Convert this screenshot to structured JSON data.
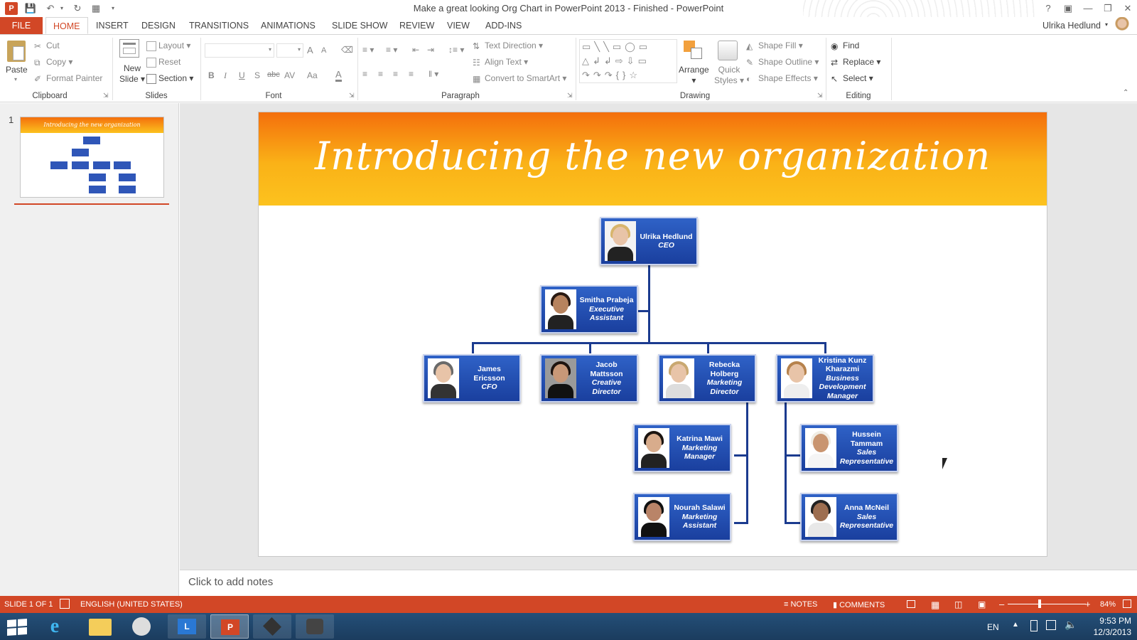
{
  "window": {
    "title": "Make a great looking Org Chart in PowerPoint 2013 - Finished - PowerPoint",
    "user": "Ulrika Hedlund",
    "help": "?"
  },
  "tabs": [
    "FILE",
    "HOME",
    "INSERT",
    "DESIGN",
    "TRANSITIONS",
    "ANIMATIONS",
    "SLIDE SHOW",
    "REVIEW",
    "VIEW",
    "ADD-INS"
  ],
  "ribbon": {
    "clipboard": {
      "paste": "Paste",
      "cut": "Cut",
      "copy": "Copy",
      "format_painter": "Format Painter",
      "label": "Clipboard"
    },
    "slides": {
      "new_slide_1": "New",
      "new_slide_2": "Slide",
      "layout": "Layout",
      "reset": "Reset",
      "section": "Section",
      "label": "Slides"
    },
    "font": {
      "label": "Font",
      "bold": "B",
      "italic": "I",
      "underline": "U",
      "shadow": "S",
      "strike": "abc",
      "spacing": "AV",
      "case": "Aa",
      "color": "A",
      "grow": "A",
      "shrink": "A"
    },
    "paragraph": {
      "label": "Paragraph",
      "text_direction": "Text Direction",
      "align_text": "Align Text",
      "convert": "Convert to SmartArt"
    },
    "drawing": {
      "label": "Drawing",
      "arrange": "Arrange",
      "quick_styles_1": "Quick",
      "quick_styles_2": "Styles",
      "shape_fill": "Shape Fill",
      "shape_outline": "Shape Outline",
      "shape_effects": "Shape Effects"
    },
    "editing": {
      "label": "Editing",
      "find": "Find",
      "replace": "Replace",
      "select": "Select"
    }
  },
  "slide_panel": {
    "number": "1"
  },
  "slide": {
    "title": "Introducing the new organization",
    "people": [
      {
        "name": "Ulrika Hedlund",
        "title": "CEO"
      },
      {
        "name": "Smitha Prabeja",
        "title": "Executive Assistant"
      },
      {
        "name": "James Ericsson",
        "title": "CFO"
      },
      {
        "name": "Jacob Mattsson",
        "title": "Creative Director"
      },
      {
        "name": "Rebecka Holberg",
        "title": "Marketing Director"
      },
      {
        "name": "Kristina Kunz Kharazmi",
        "title": "Business Development Manager"
      },
      {
        "name": "Katrina Mawi",
        "title": "Marketing Manager"
      },
      {
        "name": "Hussein Tammam",
        "title": "Sales Representative"
      },
      {
        "name": "Nourah Salawi",
        "title": "Marketing Assistant"
      },
      {
        "name": "Anna McNeil",
        "title": "Sales Representative"
      }
    ],
    "thumb_title": "Introducing the new organization"
  },
  "notes": {
    "placeholder": "Click to add notes"
  },
  "status": {
    "slide": "SLIDE 1 OF 1",
    "language": "ENGLISH (UNITED STATES)",
    "notes": "NOTES",
    "comments": "COMMENTS",
    "zoom": "84%",
    "zoom_minus": "–",
    "zoom_plus": "+"
  },
  "taskbar": {
    "lang": "EN",
    "time": "9:53 PM",
    "date": "12/3/2013"
  },
  "colors": {
    "accent": "#d24726",
    "card": "#1f4aa8",
    "banner_top": "#f46f0c",
    "banner_bottom": "#fcc21e",
    "taskbar": "#1f4466"
  }
}
